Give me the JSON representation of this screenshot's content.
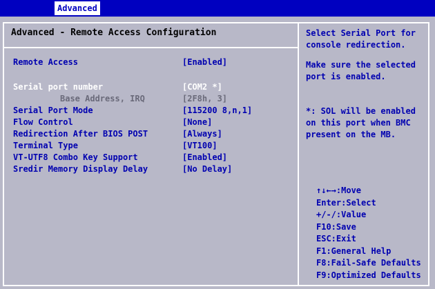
{
  "header": {
    "active_tab": "Advanced"
  },
  "main": {
    "title": "Advanced - Remote Access Configuration",
    "settings": [
      {
        "label": "Remote Access",
        "value": "[Enabled]"
      },
      {
        "label": "Serial port number",
        "value": "[COM2 *]"
      },
      {
        "label": "Base Address, IRQ",
        "value": "[2F8h, 3]"
      },
      {
        "label": "Serial Port Mode",
        "value": "[115200 8,n,1]"
      },
      {
        "label": "Flow Control",
        "value": "[None]"
      },
      {
        "label": "Redirection After BIOS POST",
        "value": "[Always]"
      },
      {
        "label": "Terminal Type",
        "value": "[VT100]"
      },
      {
        "label": "VT-UTF8 Combo Key Support",
        "value": "[Enabled]"
      },
      {
        "label": "Sredir Memory Display Delay",
        "value": "[No Delay]"
      }
    ]
  },
  "help": {
    "lines": [
      "Select Serial Port for",
      "console redirection.",
      "",
      "Make sure the selected",
      "port is enabled.",
      "",
      "*: SOL will be enabled",
      "on this port when BMC",
      "present on the MB."
    ],
    "keys": [
      "↑↓←→:Move",
      "Enter:Select",
      "+/-/:Value",
      "F10:Save",
      "ESC:Exit",
      "F1:General Help",
      "F8:Fail-Safe Defaults",
      "F9:Optimized Defaults"
    ]
  },
  "colors": {
    "background": "#b8b8c8",
    "header": "#0000c0",
    "text": "#0000b0",
    "selected": "#ffffff",
    "disabled": "#6a6a7a"
  }
}
